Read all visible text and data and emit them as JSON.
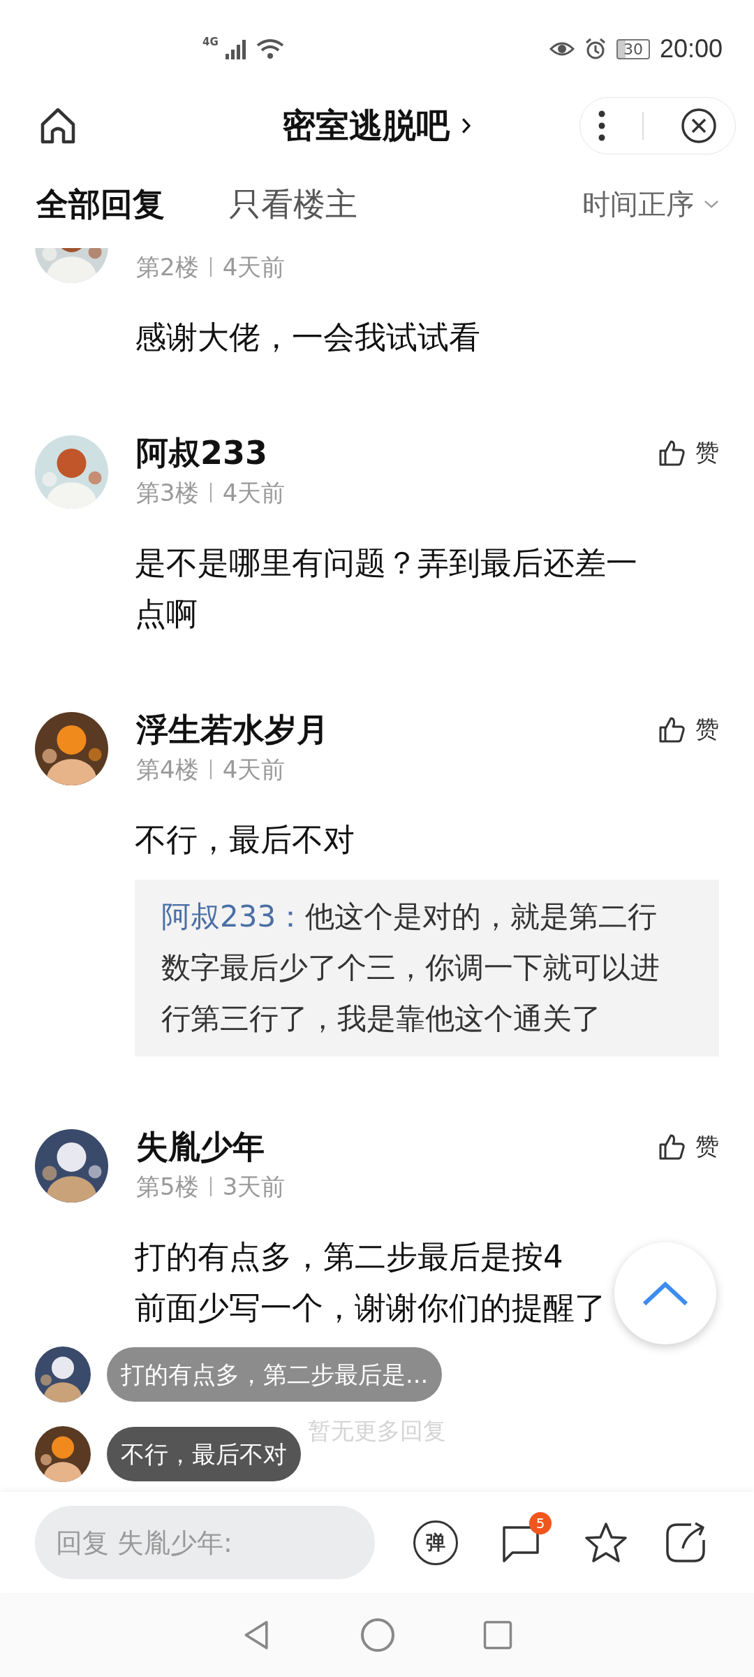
{
  "status_bar": {
    "network": "4G",
    "battery": "30",
    "time": "20:00"
  },
  "header": {
    "title": "密室逃脱吧"
  },
  "tabs": [
    {
      "label": "全部回复",
      "selected": true
    },
    {
      "label": "只看楼主",
      "selected": false
    }
  ],
  "sort": {
    "label": "时间正序"
  },
  "comments": [
    {
      "floor": "第2楼",
      "time": "4天前",
      "lines": [
        "感谢大佬，一会我试试看"
      ]
    },
    {
      "name": "阿叔233",
      "like_label": "赞",
      "floor": "第3楼",
      "time": "4天前",
      "lines": [
        "是不是哪里有问题？弄到最后还差一",
        "点啊"
      ]
    },
    {
      "name": "浮生若水岁月",
      "like_label": "赞",
      "floor": "第4楼",
      "time": "4天前",
      "lines": [
        "不行，最后不对"
      ],
      "quote": {
        "author": "阿叔233：",
        "lines": [
          "他这个是对的，就是第二行",
          "数字最后少了个三，你调一下就可以进",
          "行第三行了，我是靠他这个通关了"
        ]
      }
    },
    {
      "name": "失胤少年",
      "like_label": "赞",
      "floor": "第5楼",
      "time": "3天前",
      "lines": [
        "打的有点多，第二步最后是按4",
        "前面少写一个，谢谢你们的提醒了"
      ]
    }
  ],
  "footer_note": "暂无更多回复",
  "danmaku": [
    {
      "text": "打的有点多，第二步最后是...",
      "faded": true
    },
    {
      "text": "不行，最后不对",
      "faded": false
    }
  ],
  "reply_bar": {
    "placeholder": "回复 失胤少年:",
    "danmaku_button": "弹",
    "comment_badge": "5"
  }
}
